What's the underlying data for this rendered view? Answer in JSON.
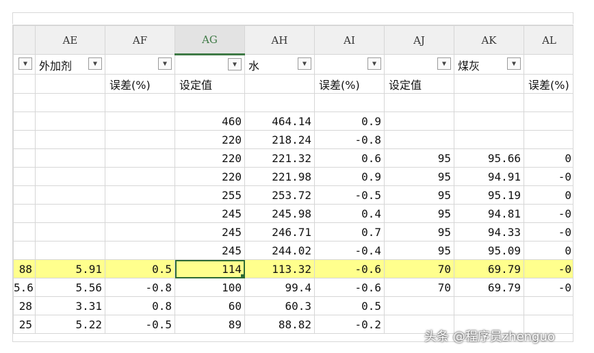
{
  "columns": [
    "",
    "AE",
    "AF",
    "AG",
    "AH",
    "AI",
    "AJ",
    "AK",
    "AL"
  ],
  "filter_row": [
    "",
    "外加剂",
    "",
    "",
    "水",
    "",
    "",
    "煤灰",
    ""
  ],
  "subheader_row": [
    "",
    "",
    "误差(%)",
    "设定值",
    "",
    "误差(%)",
    "设定值",
    "",
    "误差(%)"
  ],
  "rows": [
    [
      "",
      "",
      "",
      "460",
      "464.14",
      "0.9",
      "",
      "",
      ""
    ],
    [
      "",
      "",
      "",
      "220",
      "218.24",
      "-0.8",
      "",
      "",
      ""
    ],
    [
      "",
      "",
      "",
      "220",
      "221.32",
      "0.6",
      "95",
      "95.66",
      "0"
    ],
    [
      "",
      "",
      "",
      "220",
      "221.98",
      "0.9",
      "95",
      "94.91",
      "-0"
    ],
    [
      "",
      "",
      "",
      "255",
      "253.72",
      "-0.5",
      "95",
      "95.19",
      "0"
    ],
    [
      "",
      "",
      "",
      "245",
      "245.98",
      "0.4",
      "95",
      "94.81",
      "-0"
    ],
    [
      "",
      "",
      "",
      "245",
      "246.71",
      "0.7",
      "95",
      "94.33",
      "-0"
    ],
    [
      "",
      "",
      "",
      "245",
      "244.02",
      "-0.4",
      "95",
      "95.09",
      "0"
    ],
    [
      "88",
      "5.91",
      "0.5",
      "114",
      "113.32",
      "-0.6",
      "70",
      "69.79",
      "-0"
    ],
    [
      "5.6",
      "5.56",
      "-0.8",
      "100",
      "99.4",
      "-0.6",
      "70",
      "69.79",
      "-0"
    ],
    [
      "28",
      "3.31",
      "0.8",
      "60",
      "60.3",
      "0.5",
      "",
      "",
      ""
    ],
    [
      "25",
      "5.22",
      "-0.5",
      "89",
      "88.82",
      "-0.2",
      "",
      "",
      ""
    ]
  ],
  "highlighted_row_index": 8,
  "active_cell": "AG",
  "highlight_color": "#ffff8d",
  "watermark": "头条 @程序员zhenguo"
}
